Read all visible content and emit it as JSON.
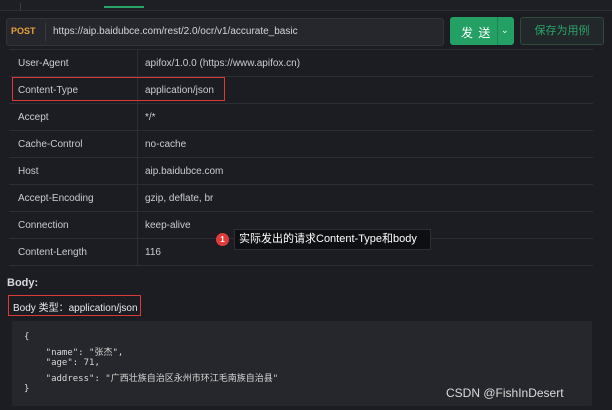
{
  "request": {
    "method": "POST",
    "url": "https://aip.baidubce.com/rest/2.0/ocr/v1/accurate_basic"
  },
  "actions": {
    "send_label": "发 送",
    "send_chevron": "⌄",
    "save_label": "保存为用例"
  },
  "headers": [
    {
      "key": "User-Agent",
      "value": "apifox/1.0.0 (https://www.apifox.cn)"
    },
    {
      "key": "Content-Type",
      "value": "application/json"
    },
    {
      "key": "Accept",
      "value": "*/*"
    },
    {
      "key": "Cache-Control",
      "value": "no-cache"
    },
    {
      "key": "Host",
      "value": "aip.baidubce.com"
    },
    {
      "key": "Accept-Encoding",
      "value": "gzip, deflate, br"
    },
    {
      "key": "Connection",
      "value": "keep-alive"
    },
    {
      "key": "Content-Length",
      "value": "116"
    }
  ],
  "annotation": {
    "badge": "1",
    "text": "实际发出的请求Content-Type和body"
  },
  "body": {
    "label": "Body:",
    "type_label": "Body 类型：application/json",
    "code_lines": [
      "{",
      "    \"name\": \"张杰\",",
      "    \"age\": 71,",
      "    \"address\": \"广西壮族自治区永州市环江毛南族自治县\"",
      "}"
    ]
  },
  "watermark": "CSDN @FishInDesert",
  "colors": {
    "accent": "#24a064",
    "method": "#e6a13a",
    "highlight": "#d83a3a",
    "background": "#1b1d22"
  }
}
